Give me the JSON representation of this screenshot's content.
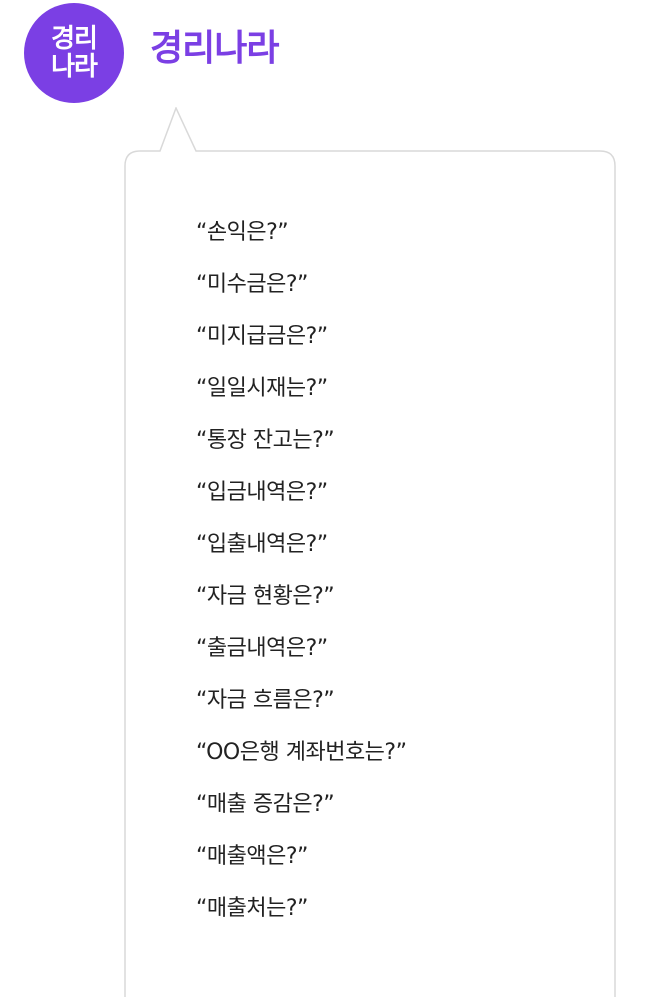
{
  "brand": {
    "avatar_line1": "경리",
    "avatar_line2": "나라",
    "name": "경리나라",
    "color": "#7b3fe4"
  },
  "questions": [
    "“손익은?”",
    "“미수금은?”",
    "“미지급금은?”",
    "“일일시재는?”",
    "“통장 잔고는?”",
    "“입금내역은?”",
    "“입출내역은?”",
    "“자금 현황은?”",
    "“출금내역은?”",
    "“자금 흐름은?”",
    "“OO은행 계좌번호는?”",
    "“매출 증감은?”",
    "“매출액은?”",
    "“매출처는?”"
  ]
}
